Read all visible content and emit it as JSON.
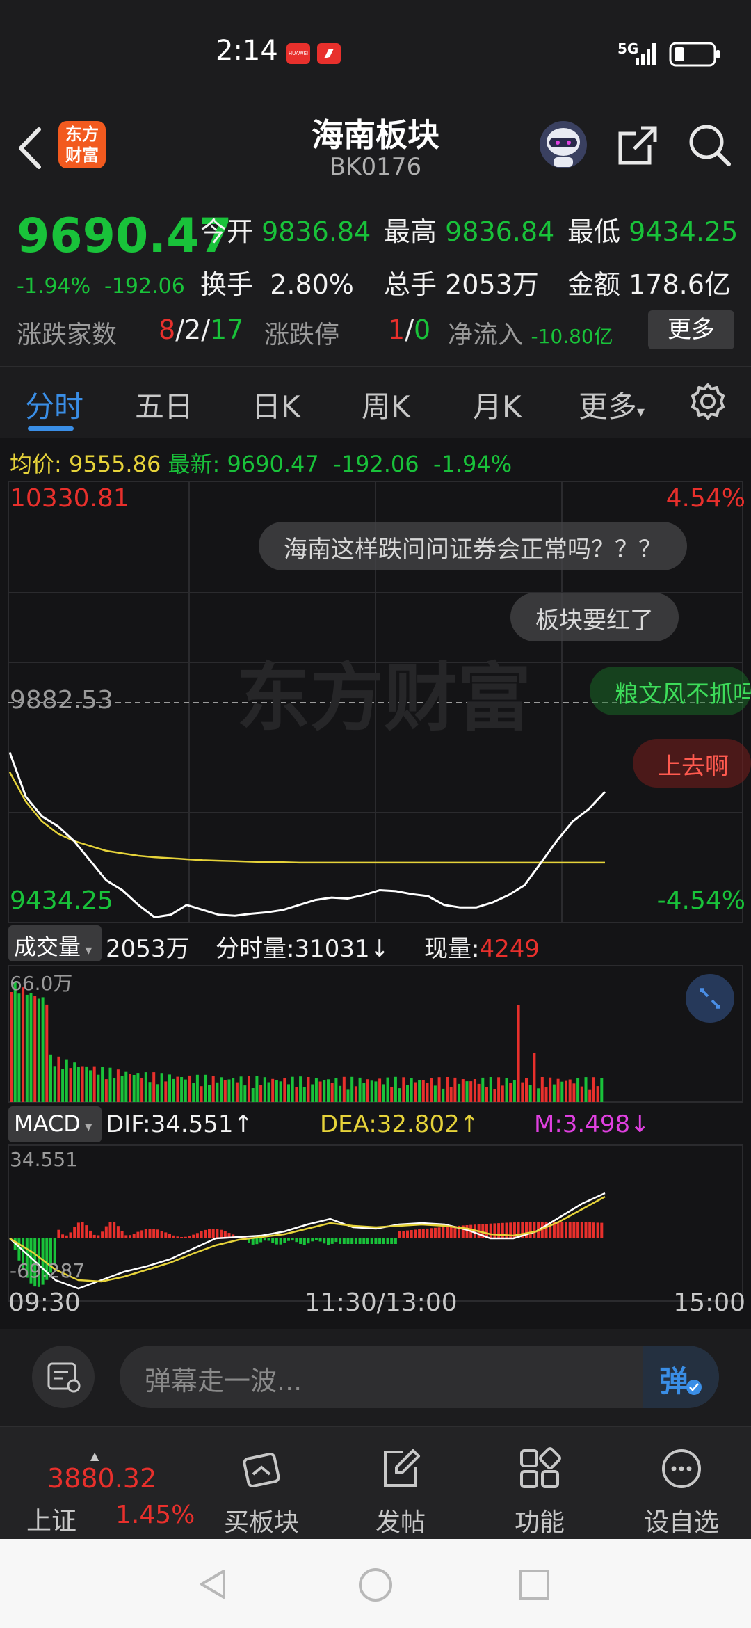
{
  "status": {
    "time": "2:14",
    "network": "5G",
    "huawei_badge": "HUAWEI"
  },
  "header": {
    "title": "海南板块",
    "code": "BK0176",
    "logo_text": "东方财富"
  },
  "quote": {
    "price": "9690.47",
    "change_pct": "-1.94%",
    "change": "-192.06",
    "open_label": "今开",
    "open": "9836.84",
    "high_label": "最高",
    "high": "9836.84",
    "low_label": "最低",
    "low": "9434.25",
    "turnover_label": "换手",
    "turnover": "2.80%",
    "volume_label": "总手",
    "volume": "2053万",
    "amount_label": "金额",
    "amount": "178.6亿",
    "breadth_label": "涨跌家数",
    "up_count": "8",
    "sep1": "/",
    "flat_count": "2",
    "sep2": "/",
    "down_count": "17",
    "limit_label": "涨跌停",
    "limit_up": "1",
    "sep3": "/",
    "limit_down": "0",
    "netflow_label": "净流入",
    "netflow": "-10.80亿",
    "more_button": "更多"
  },
  "tabs": [
    "分时",
    "五日",
    "日K",
    "周K",
    "月K",
    "更多"
  ],
  "chart_info": {
    "avg_label": "均价:",
    "avg": "9555.86",
    "latest_label": "最新:",
    "latest": "9690.47",
    "chg": "-192.06",
    "chg_pct": "-1.94%",
    "top_price": "10330.81",
    "top_pct": "4.54%",
    "mid_price": "9882.53",
    "bottom_price": "9434.25",
    "bottom_pct": "-4.54%",
    "watermark": "东方财富"
  },
  "danmu": [
    "海南这样跌问问证券会正常吗？？？",
    "板块要红了",
    "粮文风不抓吗",
    "上去啊"
  ],
  "volume_panel": {
    "selector": "成交量",
    "total": "2053万",
    "minute_label": "分时量:",
    "minute_value": "31031",
    "minute_arrow": "↓",
    "now_label": "现量:",
    "now_value": "4249",
    "max_label": "66.0万"
  },
  "macd_panel": {
    "selector": "MACD",
    "dif_label": "DIF:",
    "dif": "34.551",
    "dif_arrow": "↑",
    "dea_label": "DEA:",
    "dea": "32.802",
    "dea_arrow": "↑",
    "m_label": "M:",
    "m": "3.498",
    "m_arrow": "↓",
    "top_label": "34.551",
    "bottom_label": "-69.287"
  },
  "time_axis": [
    "09:30",
    "11:30/13:00",
    "15:00"
  ],
  "input": {
    "placeholder": "弹幕走一波...",
    "send": "弹"
  },
  "bottom_nav": {
    "index_value": "3880.32",
    "index_name": "上证",
    "index_pct": "1.45%",
    "items": [
      "买板块",
      "发帖",
      "功能",
      "设自选"
    ]
  },
  "colors": {
    "up": "#e8302c",
    "down": "#19c23a",
    "avg_line": "#e6d33a",
    "accent": "#3a8ee6",
    "macd_m": "#e040e0"
  }
}
